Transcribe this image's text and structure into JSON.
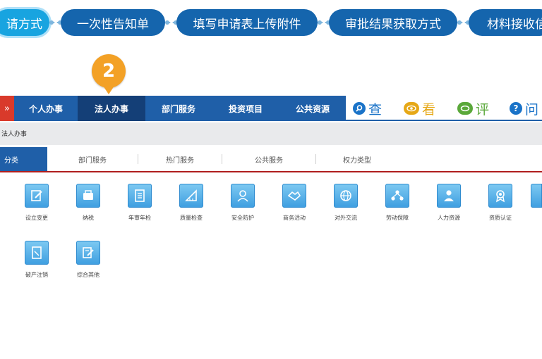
{
  "steps": [
    {
      "label": "请方式",
      "active": true
    },
    {
      "label": "一次性告知单"
    },
    {
      "label": "填写申请表上传附件"
    },
    {
      "label": "审批结果获取方式"
    },
    {
      "label": "材料接收信"
    }
  ],
  "marker": {
    "number": "2"
  },
  "navbar": {
    "arrow": "»",
    "items": [
      "个人办事",
      "法人办事",
      "部门服务",
      "投资项目",
      "公共资源"
    ],
    "active_index": 1,
    "tools": [
      {
        "icon": "search-icon",
        "label": "查",
        "color": "#1a73c8"
      },
      {
        "icon": "eye-icon",
        "label": "看",
        "color": "#e6a817"
      },
      {
        "icon": "comment-icon",
        "label": "评",
        "color": "#5aa83a"
      },
      {
        "icon": "question-icon",
        "label": "问",
        "color": "#1a73c8"
      }
    ]
  },
  "breadcrumb": {
    "text": "法人办事"
  },
  "tabs": {
    "items": [
      "分类",
      "部门服务",
      "热门服务",
      "公共服务",
      "权力类型"
    ],
    "active_index": 0
  },
  "categories": {
    "row1": [
      {
        "label": "设立变更",
        "icon": "edit-icon"
      },
      {
        "label": "纳税",
        "icon": "wallet-icon"
      },
      {
        "label": "年审年检",
        "icon": "document-icon"
      },
      {
        "label": "质量检查",
        "icon": "ruler-icon"
      },
      {
        "label": "安全防护",
        "icon": "guard-icon"
      },
      {
        "label": "商务活动",
        "icon": "handshake-icon"
      },
      {
        "label": "对外交流",
        "icon": "globe-icon"
      },
      {
        "label": "劳动保障",
        "icon": "people-network-icon"
      },
      {
        "label": "人力资源",
        "icon": "person-icon"
      },
      {
        "label": "资质认证",
        "icon": "medal-icon"
      }
    ],
    "row2": [
      {
        "label": "破产注销",
        "icon": "file-cancel-icon"
      },
      {
        "label": "综合其他",
        "icon": "misc-document-icon"
      }
    ]
  }
}
